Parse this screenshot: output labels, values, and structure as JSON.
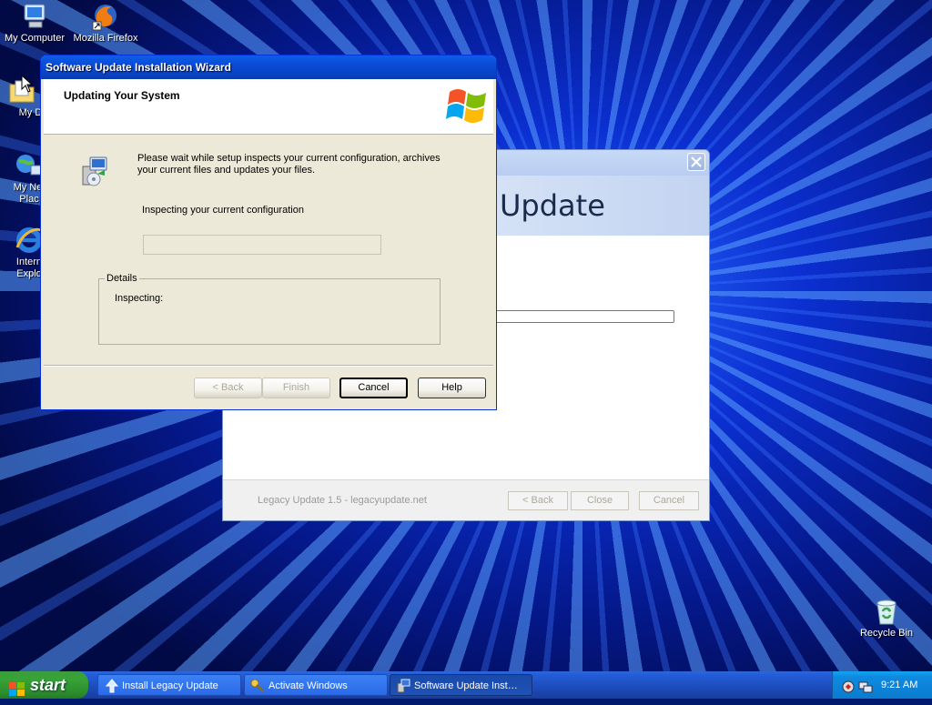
{
  "desktop": {
    "icons": [
      {
        "label": "My Computer"
      },
      {
        "label": "Mozilla Firefox"
      },
      {
        "label": "My Docu"
      },
      {
        "label": "My Net\nPlac"
      },
      {
        "label": "Intern\nExplo"
      },
      {
        "label": "Recycle Bin"
      }
    ]
  },
  "legacy_window": {
    "heading": "Update",
    "footer_text": "Legacy Update 1.5 - legacyupdate.net",
    "back_label": "< Back",
    "close_label": "Close",
    "cancel_label": "Cancel"
  },
  "wizard": {
    "title": "Software Update Installation Wizard",
    "header_title": "Updating Your System",
    "message": "Please wait while setup inspects your current configuration, archives your current files and updates your files.",
    "status": "Inspecting your current configuration",
    "progress": 0,
    "details_legend": "Details",
    "details_text": "Inspecting:",
    "back_label": "< Back",
    "finish_label": "Finish",
    "cancel_label": "Cancel",
    "help_label": "Help"
  },
  "taskbar": {
    "start_label": "start",
    "tasks": [
      {
        "label": "Install Legacy Update",
        "icon": "up-arrow-icon"
      },
      {
        "label": "Activate Windows",
        "icon": "keys-icon"
      },
      {
        "label": "Software Update Inst…",
        "icon": "setup-icon"
      }
    ],
    "clock": "9:21 AM"
  }
}
